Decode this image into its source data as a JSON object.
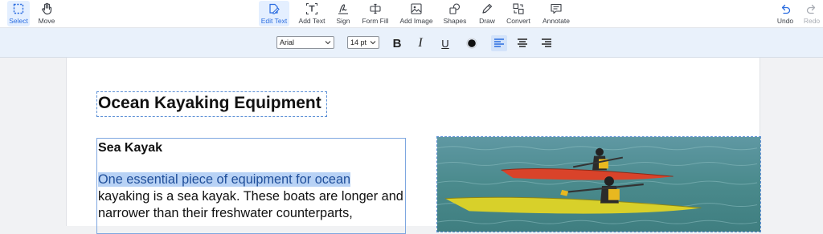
{
  "toolbar": {
    "left_tools": [
      {
        "label": "Select",
        "icon": "select-icon"
      },
      {
        "label": "Move",
        "icon": "hand-icon"
      }
    ],
    "tools": [
      {
        "label": "Edit Text",
        "icon": "edit-text-icon"
      },
      {
        "label": "Add Text",
        "icon": "add-text-icon"
      },
      {
        "label": "Sign",
        "icon": "sign-icon"
      },
      {
        "label": "Form Fill",
        "icon": "form-fill-icon"
      },
      {
        "label": "Add Image",
        "icon": "image-icon"
      },
      {
        "label": "Shapes",
        "icon": "shapes-icon"
      },
      {
        "label": "Draw",
        "icon": "pen-icon"
      },
      {
        "label": "Convert",
        "icon": "convert-icon"
      },
      {
        "label": "Annotate",
        "icon": "comment-icon"
      }
    ],
    "undo_label": "Undo",
    "redo_label": "Redo",
    "active_color": "#2b6de0"
  },
  "format": {
    "font_family": "Arial",
    "font_size": "14 pt",
    "bold": "B",
    "italic": "I",
    "underline": "U",
    "text_color": "#111111",
    "alignment": "left"
  },
  "document": {
    "title": "Ocean Kayaking Equipment",
    "section_heading": "Sea Kayak",
    "paragraph_highlighted": "One essential piece of equipment for ocean",
    "paragraph_rest": "kayaking is a sea kayak. These boats are longer and narrower than their freshwater counterparts,",
    "highlight_color": "#b8d2f5"
  }
}
